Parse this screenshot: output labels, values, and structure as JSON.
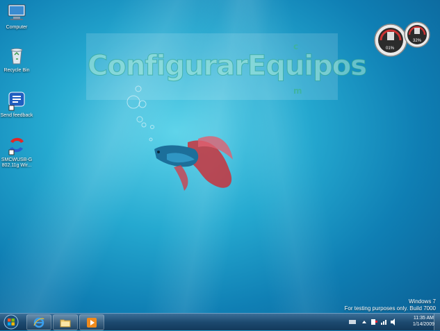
{
  "desktop": {
    "icons": [
      {
        "label": "Computer",
        "icon": "computer-icon"
      },
      {
        "label": "Recycle Bin",
        "icon": "recycle-bin-icon"
      },
      {
        "label": "Send feedback",
        "icon": "send-feedback-icon"
      },
      {
        "label": "SMCWUSB-G 802.11g Wir...",
        "icon": "smc-wireless-icon"
      }
    ],
    "watermark": {
      "text": "ConfigurarEquipos",
      "side_top": "c",
      "side_bottom": "m"
    }
  },
  "gadget": {
    "cpu_percent": "01%",
    "memory_percent": "32%"
  },
  "os_info": {
    "line1": "Windows 7",
    "line2": "For testing purposes only. Build 7000"
  },
  "taskbar": {
    "pinned": [
      {
        "name": "internet-explorer",
        "icon": "internet-explorer-icon"
      },
      {
        "name": "windows-explorer",
        "icon": "folder-icon"
      },
      {
        "name": "media-player",
        "icon": "media-player-icon"
      }
    ],
    "clock": {
      "time": "11:35 AM",
      "date": "1/14/2009"
    }
  },
  "colors": {
    "taskbar": "#1d4a70",
    "desktop": "#25a9d0"
  }
}
